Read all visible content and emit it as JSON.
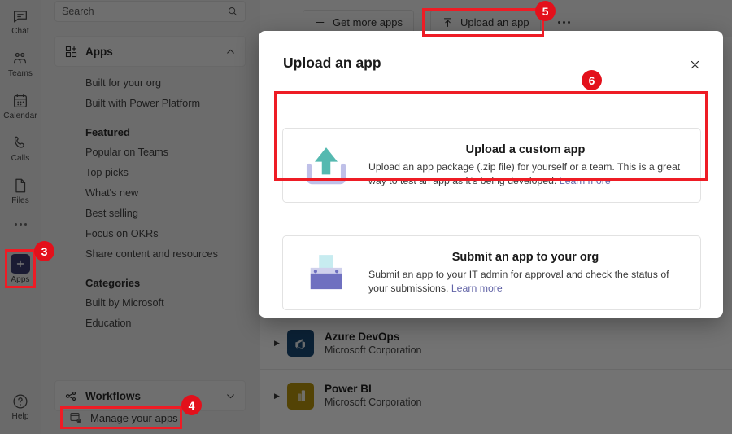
{
  "rail": {
    "items": [
      {
        "label": "Chat",
        "icon": "chat-icon"
      },
      {
        "label": "Teams",
        "icon": "teams-icon"
      },
      {
        "label": "Calendar",
        "icon": "calendar-icon"
      },
      {
        "label": "Calls",
        "icon": "calls-icon"
      },
      {
        "label": "Files",
        "icon": "files-icon"
      }
    ],
    "more_icon": "more-dots-icon",
    "apps": {
      "label": "Apps",
      "icon": "plus-tile-icon"
    },
    "help": {
      "label": "Help",
      "icon": "question-circle-icon"
    }
  },
  "nav": {
    "search": {
      "placeholder": "Search",
      "icon": "search-icon"
    },
    "apps_section": {
      "label": "Apps",
      "icon": "apps-grid-icon",
      "chevron": "chevron-up-icon"
    },
    "links_top": [
      "Built for your org",
      "Built with Power Platform"
    ],
    "featured_heading": "Featured",
    "featured": [
      "Popular on Teams",
      "Top picks",
      "What's new",
      "Best selling",
      "Focus on OKRs",
      "Share content and resources"
    ],
    "categories_heading": "Categories",
    "categories": [
      "Built by Microsoft",
      "Education"
    ],
    "workflows_section": {
      "label": "Workflows",
      "icon": "workflows-icon",
      "chevron": "chevron-down-icon"
    },
    "manage_apps": {
      "label": "Manage your apps",
      "icon": "manage-apps-icon"
    }
  },
  "toolbar": {
    "get_more_apps": {
      "label": "Get more apps",
      "icon": "plus-icon"
    },
    "upload_an_app": {
      "label": "Upload an app",
      "icon": "upload-arrow-icon"
    },
    "overflow": {
      "icon": "more-dots-icon"
    }
  },
  "app_rows": [
    {
      "name": "Azure DevOps",
      "publisher": "Microsoft Corporation",
      "icon": "azure-devops-icon",
      "color": "#1a4a75"
    },
    {
      "name": "Power BI",
      "publisher": "Microsoft Corporation",
      "icon": "power-bi-icon",
      "color": "#b8960c"
    }
  ],
  "modal": {
    "title": "Upload an app",
    "close": {
      "icon": "close-icon"
    },
    "options": [
      {
        "title": "Upload a custom app",
        "desc_before_link": "Upload an app package (.zip file) for yourself or a team. This is a great way to test an app as it's being developed. ",
        "link": "Learn more",
        "icon": "upload-tray-icon"
      },
      {
        "title": "Submit an app to your org",
        "desc_before_link": "Submit an app to your IT admin for approval and check the status of your submissions. ",
        "link": "Learn more",
        "icon": "submit-box-icon"
      }
    ]
  },
  "annotations": {
    "accent_color": "#e3101b",
    "badges": [
      {
        "number": "3",
        "target": "sidebar-item-apps"
      },
      {
        "number": "4",
        "target": "manage-your-apps"
      },
      {
        "number": "5",
        "target": "upload-an-app-button"
      },
      {
        "number": "6",
        "target": "upload-a-custom-app-card"
      }
    ]
  }
}
